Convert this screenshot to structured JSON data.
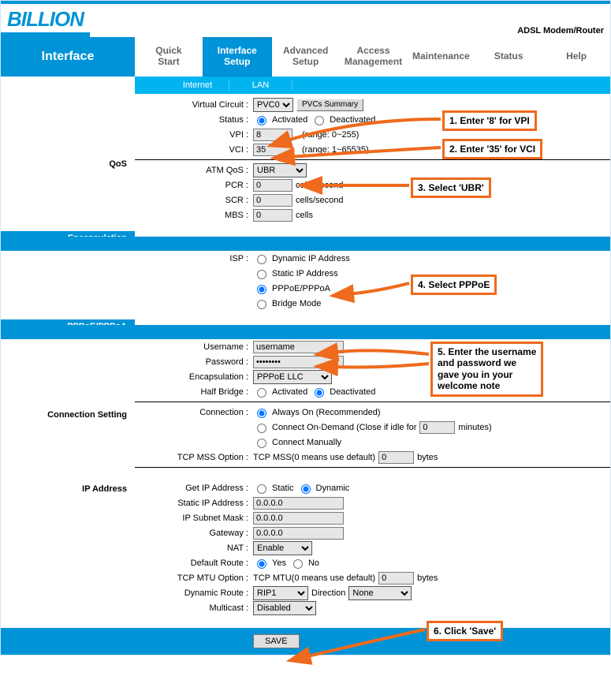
{
  "brand": "BILLION",
  "device": "ADSL Modem/Router",
  "mainTab": "Interface",
  "nav": {
    "quick": "Quick\nStart",
    "iface": "Interface\nSetup",
    "adv": "Advanced\nSetup",
    "access": "Access\nManagement",
    "maint": "Maintenance",
    "status": "Status",
    "help": "Help"
  },
  "subnav": {
    "internet": "Internet",
    "lan": "LAN"
  },
  "sections": {
    "qos": "QoS",
    "encap": "Encapsulation",
    "ppp": "PPPoE/PPPoA",
    "conn": "Connection Setting",
    "ip": "IP Address"
  },
  "labels": {
    "vc": "Virtual Circuit :",
    "status": "Status :",
    "vpi": "VPI :",
    "vci": "VCI :",
    "atmqos": "ATM QoS :",
    "pcr": "PCR :",
    "scr": "SCR :",
    "mbs": "MBS :",
    "isp": "ISP :",
    "user": "Username :",
    "pass": "Password :",
    "enc": "Encapsulation :",
    "hb": "Half Bridge :",
    "connection": "Connection :",
    "tcpmss": "TCP MSS Option :",
    "getip": "Get IP Address :",
    "static": "Static IP Address :",
    "subnet": "IP Subnet Mask :",
    "gateway": "Gateway :",
    "nat": "NAT :",
    "defroute": "Default Route :",
    "tcpmtu": "TCP MTU Option :",
    "dynrt": "Dynamic Route :",
    "mcast": "Multicast :"
  },
  "values": {
    "vc": "PVC0",
    "pvcs_btn": "PVCs Summary",
    "activated": "Activated",
    "deactivated": "Deactivated",
    "vpi": "8",
    "vpi_range": "(range: 0~255)",
    "vci": "35",
    "vci_range": "(range: 1~65535)",
    "atmqos": "UBR",
    "pcr": "0",
    "scr": "0",
    "mbs": "0",
    "cells_sec": "cells/second",
    "cells": "cells",
    "isp_dyn": "Dynamic IP Address",
    "isp_static": "Static IP Address",
    "isp_ppp": "PPPoE/PPPoA",
    "isp_bridge": "Bridge Mode",
    "user": "username",
    "pass": "********",
    "enc": "PPPoE LLC",
    "conn_always": "Always On (Recommended)",
    "conn_ondemand_pre": "Connect On-Demand (Close if idle for",
    "conn_ondemand_val": "0",
    "conn_ondemand_post": "minutes)",
    "conn_manual": "Connect Manually",
    "tcpmss_pre": "TCP MSS(0 means use default)",
    "tcpmss_val": "0",
    "bytes": "bytes",
    "getip_static": "Static",
    "getip_dynamic": "Dynamic",
    "staticip": "0.0.0.0",
    "subnet": "0.0.0.0",
    "gateway": "0.0.0.0",
    "nat": "Enable",
    "yes": "Yes",
    "no": "No",
    "tcpmtu_pre": "TCP MTU(0 means use default)",
    "tcpmtu_val": "0",
    "rip": "RIP1",
    "direction_lbl": "Direction",
    "direction": "None",
    "mcast": "Disabled",
    "save": "SAVE"
  },
  "callouts": {
    "c1": "1. Enter '8' for VPI",
    "c2": "2. Enter '35' for VCI",
    "c3": "3. Select 'UBR'",
    "c4": "4. Select PPPoE",
    "c5": "5. Enter the username\nand password we\ngave you in your\nwelcome note",
    "c6": "6. Click 'Save'"
  }
}
